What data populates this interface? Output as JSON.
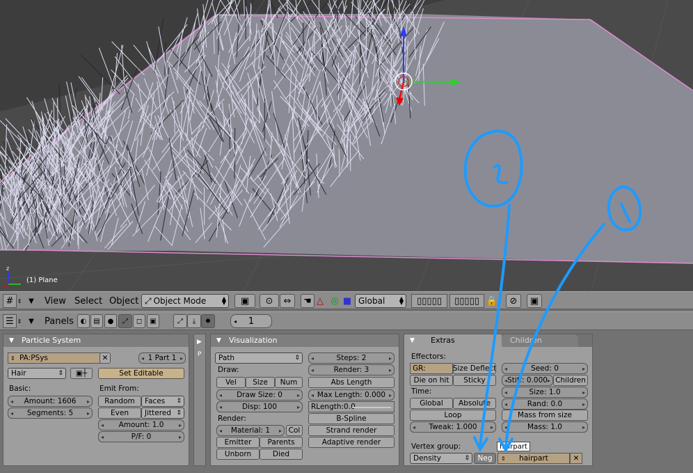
{
  "viewport": {
    "object_label": "(1) Plane"
  },
  "header1": {
    "menus": [
      "View",
      "Select",
      "Object"
    ],
    "mode": "Object Mode",
    "orientation": "Global"
  },
  "header2": {
    "panels_label": "Panels",
    "frame": "1"
  },
  "particle_system": {
    "title": "Particle System",
    "name": "PA:PSys",
    "part": "1 Part 1",
    "type": "Hair",
    "set_editable": "Set Editable",
    "basic_label": "Basic:",
    "amount": "Amount: 1606",
    "segments": "Segments: 5",
    "emit_from_label": "Emit From:",
    "random": "Random",
    "faces": "Faces",
    "even": "Even",
    "jittered": "Jittered",
    "amount2": "Amount: 1.0",
    "pf": "P/F: 0"
  },
  "visualization": {
    "title": "Visualization",
    "draw_type": "Path",
    "draw_label": "Draw:",
    "vel": "Vel",
    "size": "Size",
    "num": "Num",
    "draw_size": "Draw Size: 0",
    "disp": "Disp: 100",
    "render_label": "Render:",
    "material": "Material: 1",
    "col": "Col",
    "emitter": "Emitter",
    "parents": "Parents",
    "unborn": "Unborn",
    "died": "Died",
    "steps": "Steps: 2",
    "render": "Render: 3",
    "abs_length": "Abs Length",
    "max_length": "Max Length: 0.000",
    "rlength": "RLength:0.0",
    "bspline": "B-Spline",
    "strand_render": "Strand render",
    "adaptive_render": "Adaptive render"
  },
  "extras": {
    "tab_extras": "Extras",
    "tab_children": "Children",
    "effectors_label": "Effectors:",
    "gr": "GR:",
    "size_deflect": "Size Deflect",
    "die_on_hit": "Die on hit",
    "sticky": "Sticky",
    "time_label": "Time:",
    "global": "Global",
    "absolute": "Absolute",
    "loop": "Loop",
    "tweak": "Tweak: 1.000",
    "seed": "Seed: 0",
    "stiff": "Stiff: 0.000",
    "children": "Children",
    "size": "Size: 1.0",
    "rand": "Rand: 0.0",
    "mass_from_size": "Mass from size",
    "mass": "Mass: 1.0",
    "vertex_group_label": "Vertex group:",
    "density": "Density",
    "neg": "Neg",
    "group_name": "hairpart",
    "tooltip": "hairpart"
  },
  "annotations": {
    "mark1": "1",
    "mark2": "2"
  },
  "colors": {
    "annotation": "#1e9bff",
    "hair": "#dcdcf0",
    "plane_edge": "#e08ad0"
  }
}
